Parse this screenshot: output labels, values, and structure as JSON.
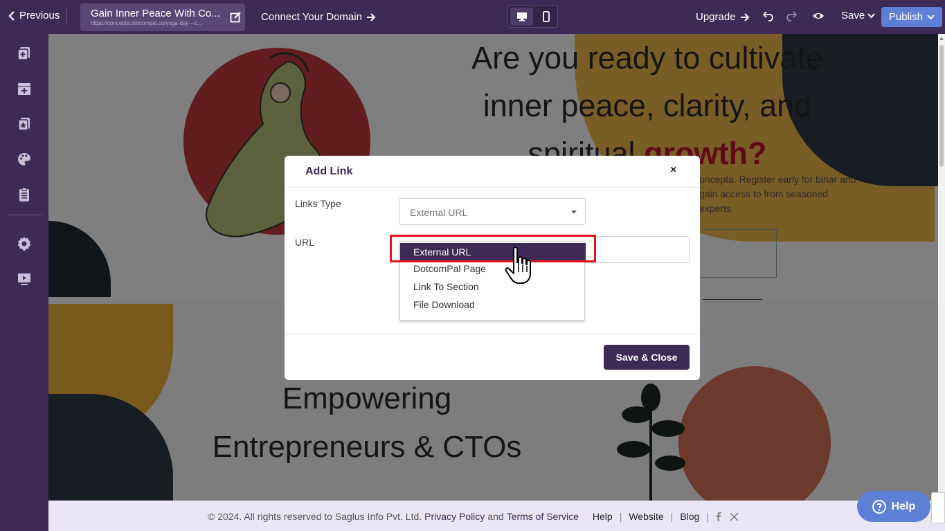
{
  "topbar": {
    "previous_label": "Previous",
    "page_title": "Gain Inner Peace With Co...",
    "page_url": "https://concepta.dotcompal.co/yoga-day---c...",
    "connect_label": "Connect Your Domain",
    "upgrade_label": "Upgrade",
    "save_label": "Save",
    "publish_label": "Publish"
  },
  "sidebar": {
    "icons": [
      "add-page-icon",
      "add-section-icon",
      "add-element-icon",
      "palette-icon",
      "clipboard-icon",
      "settings-icon",
      "preview-icon"
    ]
  },
  "canvas": {
    "hero_line1": "Are you ready to cultivate",
    "hero_line2": "inner peace, clarity, and",
    "hero_line3a": "spiritual ",
    "hero_line3b": "growth?",
    "hero_small": "oncepta. Register early for binar and gain access to from seasoned experts.",
    "lower_line1": "Empowering",
    "lower_line2": "Entrepreneurs & CTOs"
  },
  "modal": {
    "title": "Add Link",
    "close_glyph": "×",
    "links_type_label": "Links Type",
    "links_type_value": "External URL",
    "url_label": "URL",
    "save_close_label": "Save & Close",
    "options": [
      "External URL",
      "DotcomPal Page",
      "Link To Section",
      "File Download"
    ],
    "selected_index": 0
  },
  "footer": {
    "copyright": "©  2024. All rights reserved to Saglus Info Pvt. Ltd.",
    "privacy": "Privacy Policy",
    "and": "and",
    "terms": "Terms of Service",
    "help": "Help",
    "website": "Website",
    "blog": "Blog",
    "help_button": "Help"
  },
  "colors": {
    "brand": "#3d2a57",
    "accent": "#5e7fd6",
    "highlight": "#e5141c"
  }
}
